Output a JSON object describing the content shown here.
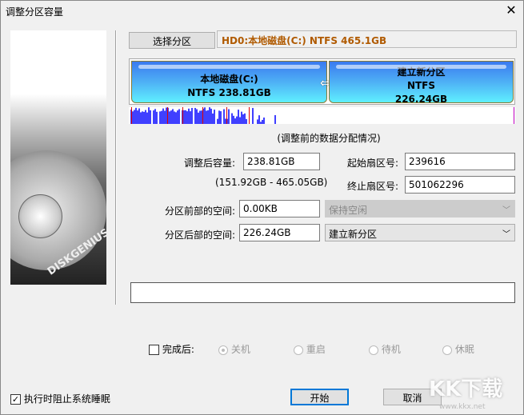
{
  "window": {
    "title": "调整分区容量",
    "close": "✕"
  },
  "sidebar": {
    "logo_text": "DISKGENIUS"
  },
  "select_partition_label": "选择分区",
  "disk_info": "HD0:本地磁盘(C:) NTFS 465.1GB",
  "partitions": [
    {
      "name": "本地磁盘(C:)",
      "detail": "NTFS 238.81GB"
    },
    {
      "name": "建立新分区",
      "fs": "NTFS",
      "size": "226.24GB"
    }
  ],
  "usage_caption": "(调整前的数据分配情况)",
  "form": {
    "new_size_label": "调整后容量:",
    "new_size": "238.81GB",
    "range": "(151.92GB - 465.05GB)",
    "start_sector_label": "起始扇区号:",
    "start_sector": "239616",
    "end_sector_label": "终止扇区号:",
    "end_sector": "501062296",
    "front_space_label": "分区前部的空间:",
    "front_space": "0.00KB",
    "front_action": "保持空闲",
    "back_space_label": "分区后部的空间:",
    "back_space": "226.24GB",
    "back_action": "建立新分区"
  },
  "after_done": {
    "label": "完成后:",
    "checked": false,
    "options": [
      "关机",
      "重启",
      "待机",
      "休眠"
    ],
    "selected": "关机"
  },
  "prevent_sleep": {
    "label": "执行时阻止系统睡眠",
    "checked": true
  },
  "buttons": {
    "start": "开始",
    "cancel": "取消"
  },
  "watermark": {
    "logo": "KK下载",
    "url": "www.kkx.net"
  },
  "colors": {
    "accent": "#0078d7",
    "disk_info": "#b05a00",
    "usage": "#4040ff"
  }
}
